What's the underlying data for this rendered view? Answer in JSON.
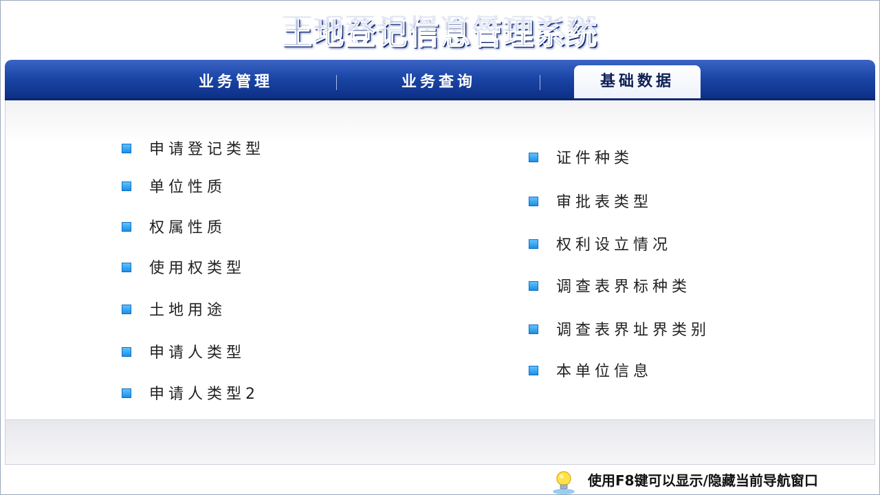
{
  "app": {
    "title": "土地登记信息管理系统"
  },
  "nav": {
    "tabs": [
      {
        "label": "业务管理"
      },
      {
        "label": "业务查询"
      },
      {
        "label": "基础数据"
      }
    ],
    "active_index": 2
  },
  "left_items": [
    "申请登记类型",
    "单位性质",
    "权属性质",
    "使用权类型",
    "土地用途",
    "申请人类型",
    "申请人类型2"
  ],
  "right_items": [
    "证件种类",
    "审批表类型",
    "权利设立情况",
    "调查表界标种类",
    "调查表界址界类别",
    "本单位信息"
  ],
  "footer": {
    "hint": "使用F8键可以显示/隐藏当前导航窗口",
    "icon": "lightbulb-icon"
  },
  "colors": {
    "nav_blue": "#1b47a8",
    "bullet_blue": "#3aa7f2",
    "title_blue": "#1c3a95"
  }
}
